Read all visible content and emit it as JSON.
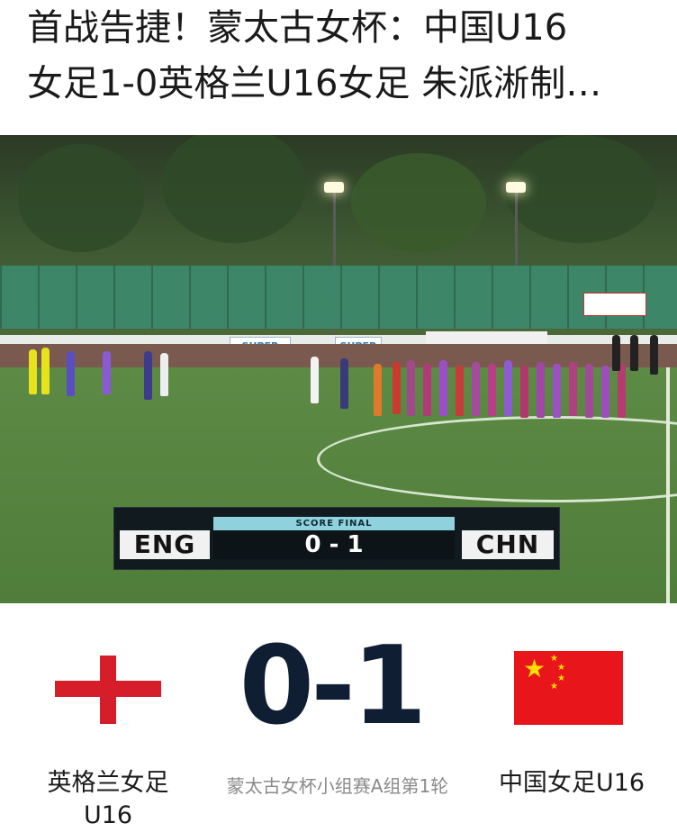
{
  "article": {
    "title_line1": "首战告捷！蒙太古女杯：中国U16",
    "title_line2": "女足1-0英格兰U16女足 朱派淅制…"
  },
  "photo": {
    "boards": [
      "SUPER",
      "SUPER"
    ],
    "scoreboard": {
      "label": "SCORE FINAL",
      "home_code": "ENG",
      "away_code": "CHN",
      "score": "0 - 1"
    }
  },
  "match_card": {
    "home_team": "英格兰女足U16",
    "away_team": "中国女足U16",
    "score": "0-1",
    "competition_round": "蒙太古女杯小组赛A组第1轮",
    "home_flag_icon": "england-flag-icon",
    "away_flag_icon": "china-flag-icon"
  },
  "colors": {
    "score_text": "#0f1e33",
    "england_red": "#d61e2b",
    "china_red": "#e8151b",
    "china_star": "#ffde00",
    "scorebug_accent": "#8fd1dc"
  }
}
